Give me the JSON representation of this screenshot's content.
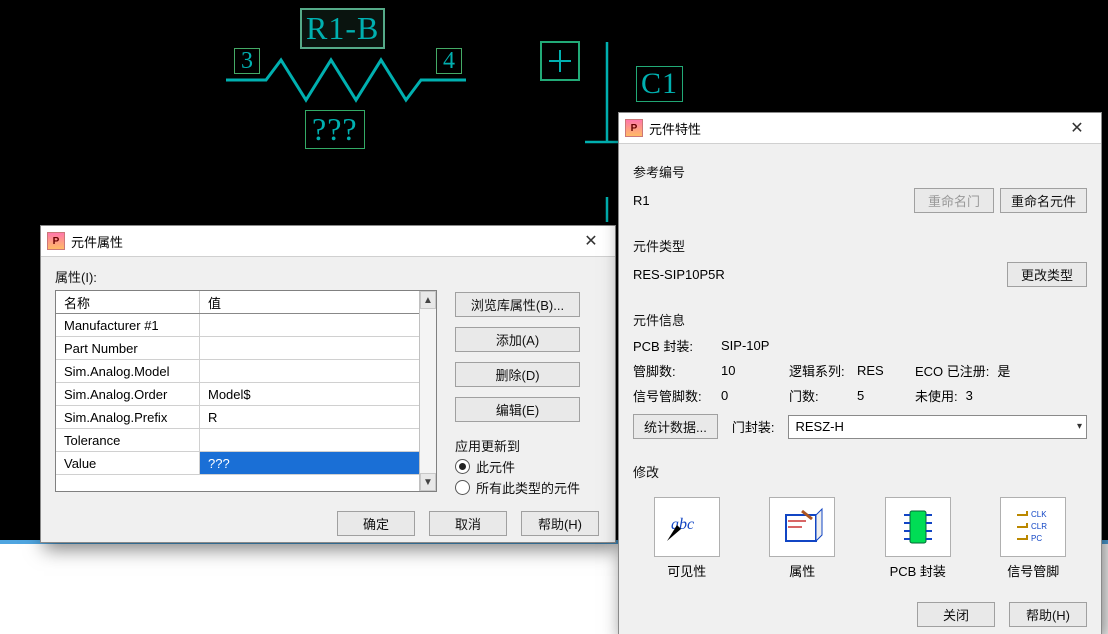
{
  "schematic": {
    "ref_label": "R1-B",
    "pin_left": "3",
    "pin_right": "4",
    "value_label": "???",
    "cap_plus": "+",
    "cap_name": "C1"
  },
  "dlg1": {
    "title": "元件属性",
    "section_label": "属性(I):",
    "columns": {
      "name": "名称",
      "value": "值"
    },
    "rows": [
      {
        "name": "Manufacturer #1",
        "value": ""
      },
      {
        "name": "Part Number",
        "value": ""
      },
      {
        "name": "Sim.Analog.Model",
        "value": ""
      },
      {
        "name": "Sim.Analog.Order",
        "value": "Model$"
      },
      {
        "name": "Sim.Analog.Prefix",
        "value": "R"
      },
      {
        "name": "Tolerance",
        "value": ""
      },
      {
        "name": "Value",
        "value": "???"
      }
    ],
    "selected_row_index": 6,
    "buttons": {
      "browse_lib": "浏览库属性(B)...",
      "add": "添加(A)",
      "delete": "删除(D)",
      "edit": "编辑(E)"
    },
    "apply_label": "应用更新到",
    "apply_this": "此元件",
    "apply_all": "所有此类型的元件",
    "apply_choice": "this",
    "footer": {
      "ok": "确定",
      "cancel": "取消",
      "help": "帮助(H)"
    }
  },
  "dlg2": {
    "title": "元件特性",
    "ref_section": "参考编号",
    "ref_value": "R1",
    "rename_gate": "重命名门",
    "rename_comp": "重命名元件",
    "type_section": "元件类型",
    "type_value": "RES-SIP10P5R",
    "change_type": "更改类型",
    "info_section": "元件信息",
    "info": {
      "pcb_pkg_label": "PCB 封装:",
      "pcb_pkg_value": "SIP-10P",
      "pin_count_label": "管脚数:",
      "pin_count_value": "10",
      "logic_label": "逻辑系列:",
      "logic_value": "RES",
      "eco_label": "ECO 已注册:",
      "eco_value": "是",
      "sig_pin_label": "信号管脚数:",
      "sig_pin_value": "0",
      "gate_count_label": "门数:",
      "gate_count_value": "5",
      "unused_label": "未使用:",
      "unused_value": "3",
      "stats_btn": "统计数据...",
      "gate_pkg_label": "门封装:",
      "gate_pkg_value": "RESZ-H"
    },
    "modify_section": "修改",
    "modify": {
      "visibility": "可见性",
      "attributes": "属性",
      "pcb_pkg": "PCB 封装",
      "sig_pins": "信号管脚"
    },
    "footer": {
      "close": "关闭",
      "help": "帮助(H)"
    }
  }
}
